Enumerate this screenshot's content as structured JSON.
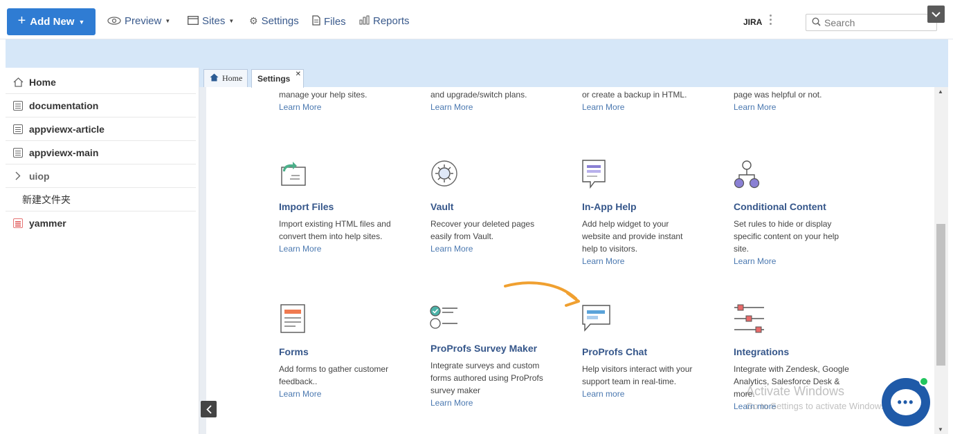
{
  "topbar": {
    "add_new": "Add New",
    "preview": "Preview",
    "sites": "Sites",
    "settings": "Settings",
    "files": "Files",
    "reports": "Reports",
    "jira": "JIRA",
    "search_placeholder": "Search"
  },
  "sidebar": {
    "items": [
      {
        "label": "Home"
      },
      {
        "label": "documentation"
      },
      {
        "label": "appviewx-article"
      },
      {
        "label": "appviewx-main"
      },
      {
        "label": "uiop"
      },
      {
        "label": "新建文件夹"
      },
      {
        "label": "yammer"
      }
    ]
  },
  "tabs": [
    {
      "label": "Home"
    },
    {
      "label": "Settings"
    }
  ],
  "top_row": [
    {
      "text": "manage your help sites.",
      "more": "Learn More"
    },
    {
      "text": "and upgrade/switch plans.",
      "more": "Learn More"
    },
    {
      "text": "or create a backup in HTML.",
      "more": "Learn More"
    },
    {
      "text": "page was helpful or not.",
      "more": "Learn More"
    }
  ],
  "cards": [
    {
      "title": "Import Files",
      "desc": "Import existing HTML files and convert them into help sites.",
      "more": "Learn More",
      "icon": "import-files-icon"
    },
    {
      "title": "Vault",
      "desc": "Recover your deleted pages easily from Vault.",
      "more": "Learn More",
      "icon": "vault-icon"
    },
    {
      "title": "In-App Help",
      "desc": "Add help widget to your website and provide instant help to visitors.",
      "more": "Learn More",
      "icon": "in-app-help-icon"
    },
    {
      "title": "Conditional Content",
      "desc": "Set rules to hide or display specific content on your help site.",
      "more": "Learn More",
      "icon": "conditional-content-icon"
    },
    {
      "title": "Forms",
      "desc": "Add forms to gather customer feedback..",
      "more": "Learn More",
      "icon": "forms-icon"
    },
    {
      "title": "ProProfs Survey Maker",
      "desc": "Integrate surveys and custom forms authored using ProProfs survey maker",
      "more": "Learn More",
      "icon": "survey-maker-icon"
    },
    {
      "title": "ProProfs Chat",
      "desc": "Help visitors interact with your support team in real-time.",
      "more": "Learn more",
      "icon": "chat-icon"
    },
    {
      "title": "Integrations",
      "desc": "Integrate with Zendesk, Google Analytics, Salesforce Desk & more.",
      "more": "Learn more",
      "icon": "integrations-icon"
    }
  ],
  "watermark": {
    "line1": "Activate Windows",
    "line2": "Go to Settings to activate Windows."
  },
  "colors": {
    "accent": "#2f7cd3",
    "title": "#35568a",
    "link": "#4a78b0",
    "band": "#d6e7f8",
    "arrow": "#f0a030"
  }
}
